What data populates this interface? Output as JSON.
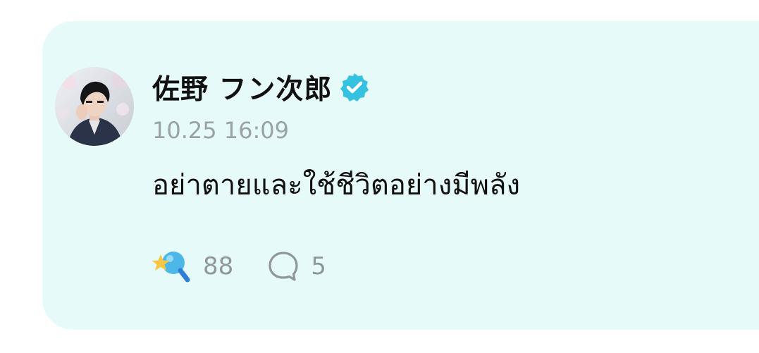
{
  "post": {
    "author_name": "佐野 フン次郎",
    "verified": true,
    "timestamp": "10.25 16:09",
    "text": "อย่าตายและใช้ชีวิตอย่างมีพลัง",
    "reactions": {
      "icon": "star-magnifier-reaction-icon",
      "count": "88"
    },
    "comments": {
      "icon": "speech-bubble-icon",
      "count": "5"
    }
  },
  "colors": {
    "card_background": "#e6fbf9",
    "verified_badge": "#35c2e0",
    "meta_text": "#9aa1a8"
  }
}
